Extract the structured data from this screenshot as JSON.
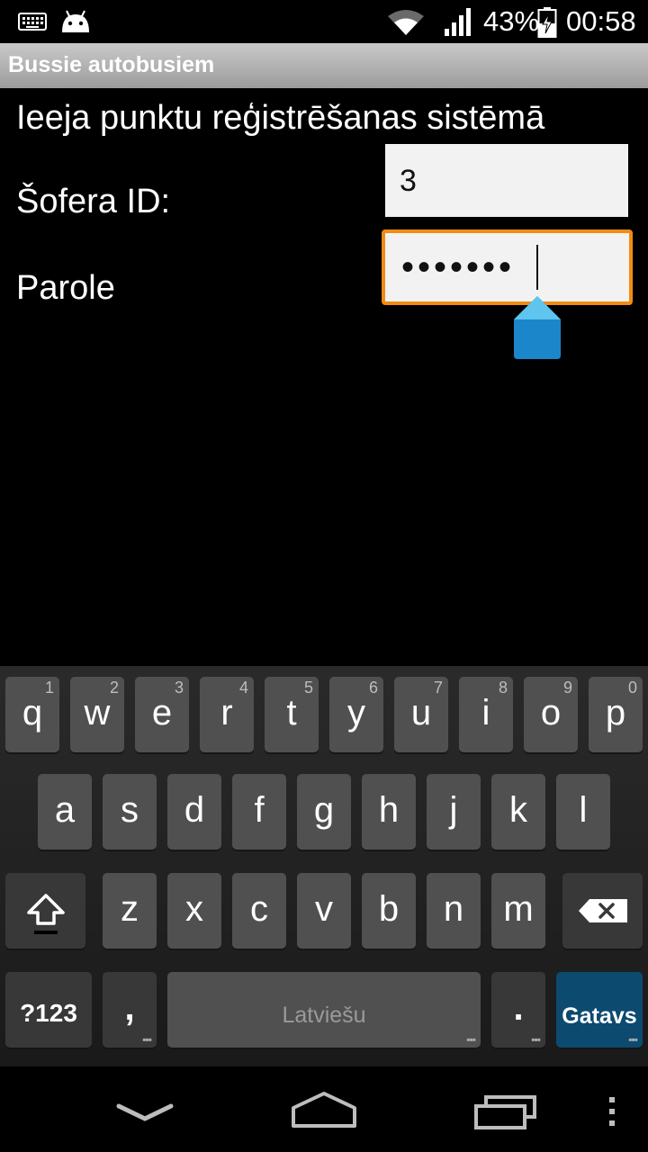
{
  "status_bar": {
    "battery_percent": "43%",
    "time": "00:58",
    "icons": [
      "keyboard-icon",
      "android-icon",
      "wifi-icon",
      "signal-icon",
      "battery-charging-icon"
    ]
  },
  "app": {
    "title": "Bussie autobusiem"
  },
  "form": {
    "heading": "Ieeja punktu reģistrēšanas sistēmā",
    "driver_id_label": "Šofera ID:",
    "driver_id_value": "3",
    "password_label": "Parole",
    "password_masked": "•••••••"
  },
  "keyboard": {
    "row1": [
      {
        "key": "q",
        "hint": "1"
      },
      {
        "key": "w",
        "hint": "2"
      },
      {
        "key": "e",
        "hint": "3"
      },
      {
        "key": "r",
        "hint": "4"
      },
      {
        "key": "t",
        "hint": "5"
      },
      {
        "key": "y",
        "hint": "6"
      },
      {
        "key": "u",
        "hint": "7"
      },
      {
        "key": "i",
        "hint": "8"
      },
      {
        "key": "o",
        "hint": "9"
      },
      {
        "key": "p",
        "hint": "0"
      }
    ],
    "row2": [
      "a",
      "s",
      "d",
      "f",
      "g",
      "h",
      "j",
      "k",
      "l"
    ],
    "row3": [
      "z",
      "x",
      "c",
      "v",
      "b",
      "n",
      "m"
    ],
    "symbols_label": "?123",
    "comma": ",",
    "space_label": "Latviešu",
    "period": ".",
    "action_label": "Gatavs",
    "action_color": "#0c4a70"
  },
  "nav_bar": {
    "icons": [
      "back-icon",
      "home-icon",
      "recent-apps-icon",
      "menu-icon"
    ]
  },
  "accent_color": "#f08c12"
}
